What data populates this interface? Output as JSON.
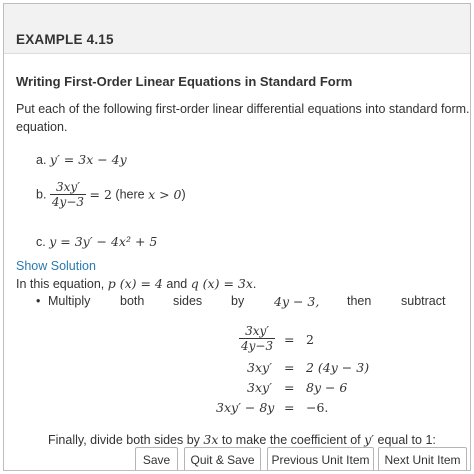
{
  "header": {
    "title": "EXAMPLE 4.15"
  },
  "section": {
    "title": "Writing First-Order Linear Equations in Standard Form",
    "intro_line1": "Put each of the following first-order linear differential equations into standard form.",
    "intro_line2": "equation."
  },
  "problems": {
    "a_label": "a.",
    "a_eq": "y′ = 3x − 4y",
    "b_label": "b.",
    "b_num": "3xy′",
    "b_den": "4y−3",
    "b_rhs": "= 2",
    "b_note_prefix": "(here ",
    "b_note_math": "x > 0",
    "b_note_suffix": ")",
    "c_label": "c.",
    "c_eq": "y = 3y′ − 4x² + 5"
  },
  "solution": {
    "toggle_label": "Show Solution",
    "intro_prefix": "In this equation, ",
    "p_expr": "p (x) = 4",
    "and_text": " and ",
    "q_expr": "q (x) = 3x",
    "intro_suffix": ".",
    "bullet_words": [
      "Multiply",
      "both",
      "sides",
      "by",
      "4y − 3,",
      "then",
      "subtract"
    ],
    "eq_rows": [
      {
        "lhs_num": "3xy′",
        "lhs_den": "4y−3",
        "op": "=",
        "rhs": "2"
      },
      {
        "lhs": "3xy′",
        "op": "=",
        "rhs": "2 (4y − 3)"
      },
      {
        "lhs": "3xy′",
        "op": "=",
        "rhs": "8y − 6"
      },
      {
        "lhs": "3xy′ − 8y",
        "op": "=",
        "rhs": "−6."
      }
    ],
    "final_prefix": "Finally, divide both sides by ",
    "final_math1": "3x",
    "final_mid": " to make the coefficient of ",
    "final_math2": "y′",
    "final_suffix": " equal to 1:"
  },
  "footer": {
    "save": "Save",
    "quit_save": "Quit & Save",
    "previous": "Previous Unit Item",
    "next": "Next Unit Item"
  }
}
